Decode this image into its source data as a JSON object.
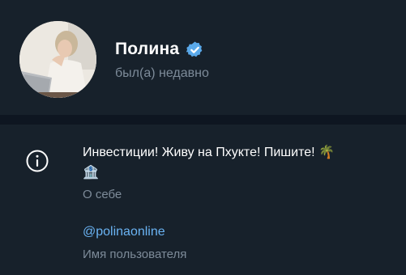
{
  "profile": {
    "name": "Полина",
    "status": "был(а) недавно",
    "verified": true,
    "avatar_icon": "profile-photo"
  },
  "info": {
    "icon": "info-icon",
    "bio_text": "Инвестиции! Живу на Пхукте! Пишите!",
    "bio_emojis": [
      "🌴",
      "🏦"
    ],
    "bio_label": "О себе",
    "username": "@polinaonline",
    "username_label": "Имя пользователя"
  },
  "colors": {
    "background": "#17212b",
    "divider": "#0e1621",
    "accent_link": "#6ab3f3",
    "verified_badge": "#5aa9ea",
    "muted_text": "#7d8b99"
  }
}
